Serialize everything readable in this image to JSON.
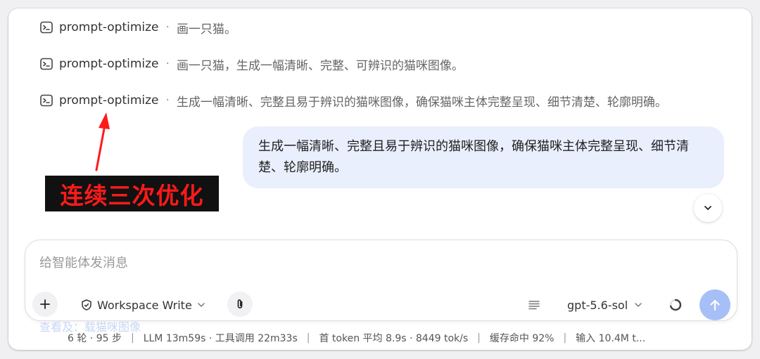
{
  "messages": {
    "tool_calls": [
      {
        "name": "prompt-optimize",
        "separator": "·",
        "text": "画一只猫。"
      },
      {
        "name": "prompt-optimize",
        "separator": "·",
        "text": "画一只猫，生成一幅清晰、完整、可辨识的猫咪图像。"
      },
      {
        "name": "prompt-optimize",
        "separator": "·",
        "text": "生成一幅清晰、完整且易于辨识的猫咪图像，确保猫咪主体完整呈现、细节清楚、轮廓明确。"
      }
    ],
    "user_bubble": "生成一幅清晰、完整且易于辨识的猫咪图像，确保猫咪主体完整呈现、细节清楚、轮廓明确。"
  },
  "annotation": {
    "label": "连续三次优化",
    "color": "#ff1a1a"
  },
  "composer": {
    "placeholder": "给智能体发消息",
    "value": "",
    "workspace_mode": "Workspace Write",
    "model": "gpt-5.6-sol"
  },
  "footer": {
    "ghost_link": "查看及：载猫咪图像",
    "status": {
      "turns": "6 轮 · 95 步",
      "llm": "LLM 13m59s · 工具调用 22m33s",
      "first_token": "首 token 平均 8.9s · 8449 tok/s",
      "cache": "缓存命中 92%",
      "input": "输入 10.4M t..."
    }
  },
  "colors": {
    "bubble_bg": "#e9effc",
    "send_button": "#a7bff7",
    "annotation_red": "#ff1a1a"
  },
  "icons": [
    "terminal-icon",
    "plus-icon",
    "shield-icon",
    "chevron-down-icon",
    "paperclip-icon",
    "list-icon",
    "spinner-icon",
    "arrow-up-icon"
  ]
}
